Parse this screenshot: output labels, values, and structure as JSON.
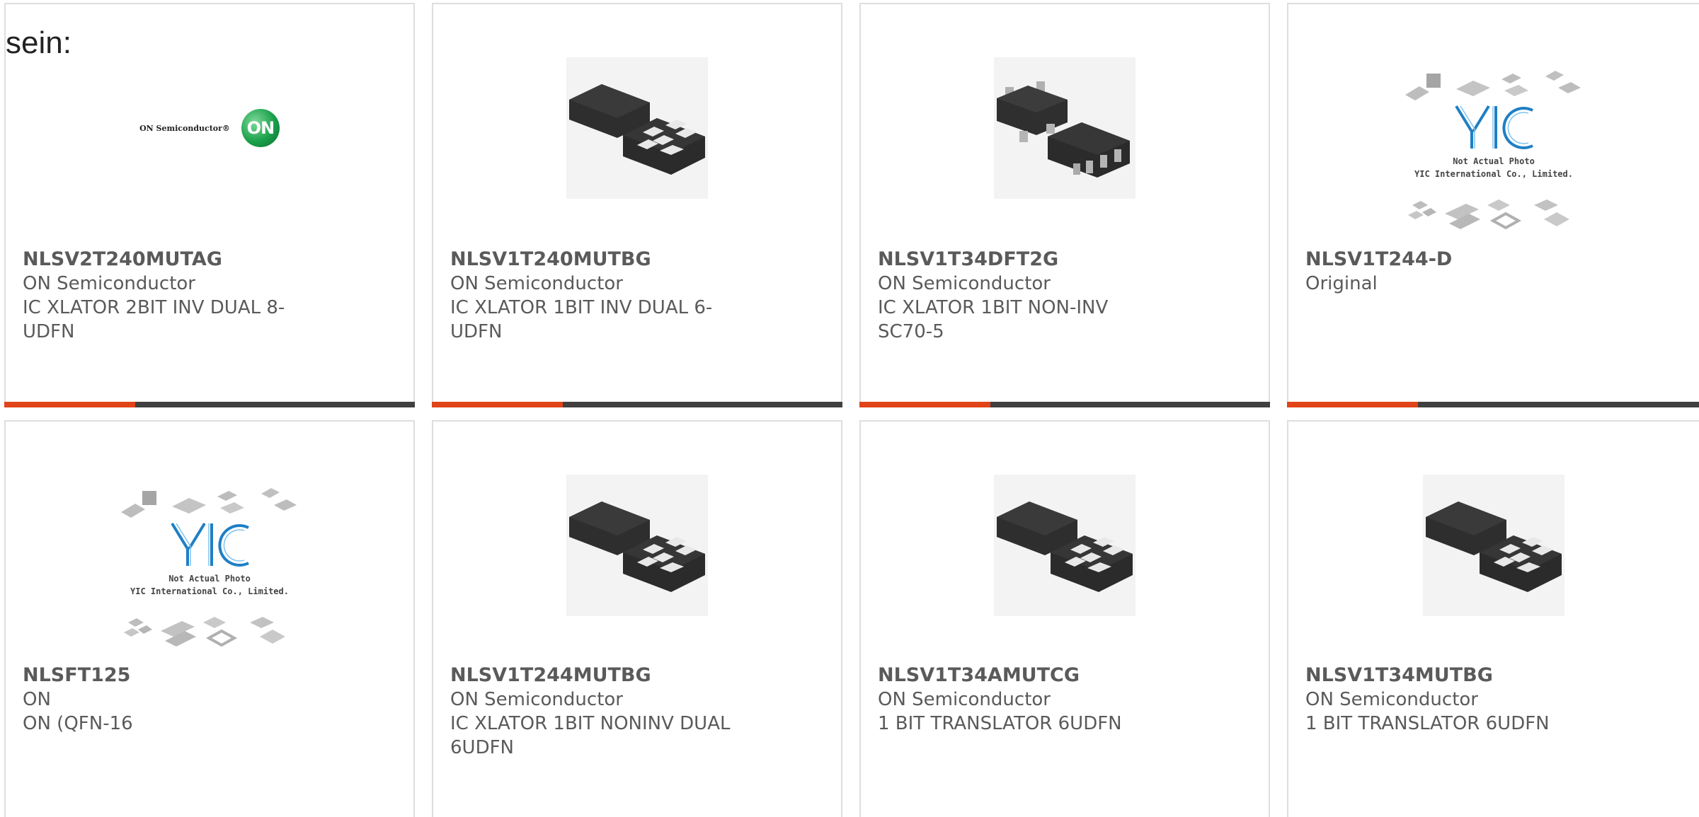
{
  "header": {
    "text": "sein:"
  },
  "colors": {
    "accent": "#e04418",
    "bar": "#404040",
    "border": "#dedede",
    "text": "#5a5a5a",
    "on_logo_green": "#19a04a"
  },
  "logos": {
    "on_semiconductor_text": "ON Semiconductor®",
    "on_badge": "ON",
    "yic_caption_line1": "Not Actual Photo",
    "yic_caption_line2": "YIC International Co., Limited."
  },
  "products": [
    {
      "part_number": "NLSV2T240MUTAG",
      "manufacturer": "ON Semiconductor",
      "description": "IC XLATOR 2BIT INV DUAL 8-UDFN",
      "image": "on-semiconductor-logo"
    },
    {
      "part_number": "NLSV1T240MUTBG",
      "manufacturer": "ON Semiconductor",
      "description": "IC XLATOR 1BIT INV DUAL 6-UDFN",
      "image": "udfn-package-photo"
    },
    {
      "part_number": "NLSV1T34DFT2G",
      "manufacturer": "ON Semiconductor",
      "description": "IC XLATOR 1BIT NON-INV SC70-5",
      "image": "sc70-package-photo"
    },
    {
      "part_number": "NLSV1T244-D",
      "manufacturer": "Original",
      "description": "",
      "image": "yic-placeholder"
    },
    {
      "part_number": "NLSFT125",
      "manufacturer": "ON",
      "description": "ON (QFN-16",
      "image": "yic-placeholder"
    },
    {
      "part_number": "NLSV1T244MUTBG",
      "manufacturer": "ON Semiconductor",
      "description": "IC XLATOR 1BIT NONINV DUAL 6UDFN",
      "image": "udfn-package-photo"
    },
    {
      "part_number": "NLSV1T34AMUTCG",
      "manufacturer": "ON Semiconductor",
      "description": "1 BIT TRANSLATOR 6UDFN",
      "image": "udfn-package-photo"
    },
    {
      "part_number": "NLSV1T34MUTBG",
      "manufacturer": "ON Semiconductor",
      "description": "1 BIT TRANSLATOR 6UDFN",
      "image": "udfn-package-photo"
    }
  ]
}
